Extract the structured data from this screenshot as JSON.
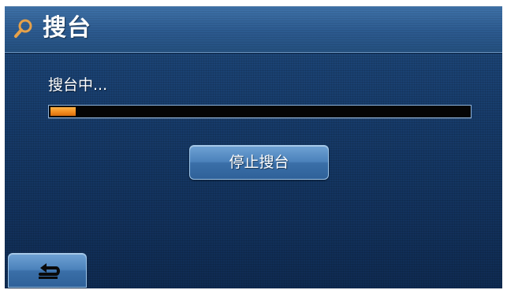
{
  "header": {
    "title": "搜台",
    "icon": "search-icon"
  },
  "status": {
    "text": "搜台中..."
  },
  "progress": {
    "fraction": 0.06,
    "fill_color": "#f28a1d"
  },
  "actions": {
    "stop_label": "停止搜台"
  },
  "navigation": {
    "back_icon": "back-arrow-icon"
  },
  "colors": {
    "background": "#163a68",
    "header": "#2c5a8f",
    "button": "#4b82bb",
    "text": "#ffffff"
  }
}
